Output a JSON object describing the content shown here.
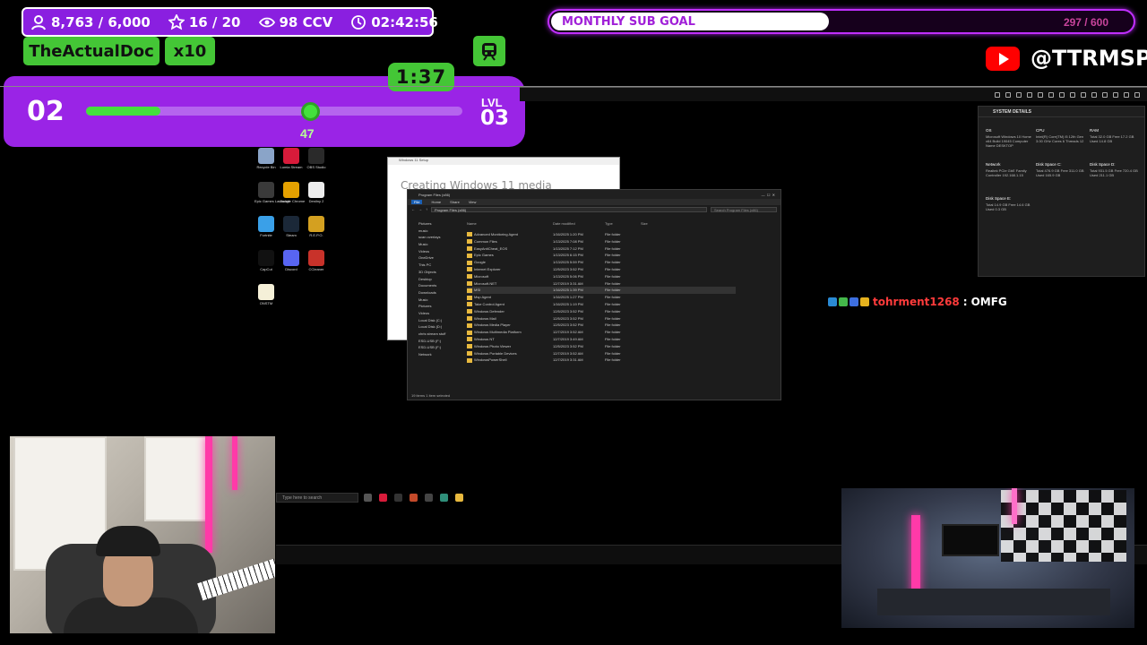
{
  "overlay": {
    "stats": {
      "followers": "8,763 / 6,000",
      "subs": "16 / 20",
      "viewers": "98 CCV",
      "uptime": "02:42:56"
    },
    "user_name": "TheActualDoc",
    "multiplier": "x10",
    "timer": "1:37",
    "level": {
      "current": "02",
      "next_label": "LVL",
      "next": "03",
      "progress_value": "47",
      "progress_fraction": 0.6
    },
    "goal": {
      "label": "MONTHLY SUB GOAL",
      "value": "297 / 600",
      "fraction": 0.495
    },
    "youtube_handle": "@TTRMSP",
    "chat": {
      "user": "tohrment1268",
      "separator": ":",
      "message": "OMFG"
    }
  },
  "desktop": {
    "icons": [
      {
        "label": "Recycle Bin",
        "color": "#8aa4c8"
      },
      {
        "label": "Lumia Stream",
        "color": "#d81b3a"
      },
      {
        "label": "OBS Studio",
        "color": "#2a2a2a"
      },
      {
        "label": "Epic Games Launcher",
        "color": "#3a3a3a"
      },
      {
        "label": "Google Chrome",
        "color": "#e5a100"
      },
      {
        "label": "Destiny 2",
        "color": "#ececec"
      },
      {
        "label": "Fortnite",
        "color": "#3aa0e8"
      },
      {
        "label": "Steam",
        "color": "#1b2838"
      },
      {
        "label": "R.E.P.O.",
        "color": "#d4a020"
      },
      {
        "label": "CapCut",
        "color": "#111111"
      },
      {
        "label": "Discord",
        "color": "#5865f2"
      },
      {
        "label": "CCleaner",
        "color": "#c8322a"
      },
      {
        "label": "ONSTM",
        "color": "#f5f0d8"
      }
    ],
    "bg_window": {
      "title": "Windows 11 Setup",
      "heading": "Creating Windows 11 media"
    },
    "explorer": {
      "title": "Program Files (x86)",
      "ribbon": [
        "File",
        "Home",
        "Share",
        "View"
      ],
      "path": "Program Files (x86)",
      "search_placeholder": "Search Program Files (x86)",
      "nav": [
        "Pictures",
        "music",
        "scan overlays",
        "Music",
        "Videos",
        "OneDrive",
        "This PC",
        "3D Objects",
        "Desktop",
        "Documents",
        "Downloads",
        "Music",
        "Pictures",
        "Videos",
        "Local Disk (C:)",
        "Local Disk (D:)",
        "chris stream stuff",
        "ESD-USB (F:)",
        "ESD-USB (F:)",
        "Network"
      ],
      "columns": [
        "Name",
        "Date modified",
        "Type",
        "Size"
      ],
      "rows": [
        {
          "name": "Advanced Monitoring Agent",
          "date": "1/16/2025 1:20 PM",
          "type": "File folder"
        },
        {
          "name": "Common Files",
          "date": "1/13/2025 7:08 PM",
          "type": "File folder"
        },
        {
          "name": "EasyAntiCheat_EOS",
          "date": "1/13/2025 7:12 PM",
          "type": "File folder"
        },
        {
          "name": "Epic Games",
          "date": "1/13/2025 6:15 PM",
          "type": "File folder"
        },
        {
          "name": "Google",
          "date": "1/13/2025 5:59 PM",
          "type": "File folder"
        },
        {
          "name": "Internet Explorer",
          "date": "12/5/2023 3:52 PM",
          "type": "File folder"
        },
        {
          "name": "Microsoft",
          "date": "1/13/2025 5:06 PM",
          "type": "File folder"
        },
        {
          "name": "Microsoft.NET",
          "date": "12/7/2019 3:31 AM",
          "type": "File folder"
        },
        {
          "name": "MSI",
          "date": "1/16/2025 1:39 PM",
          "type": "File folder"
        },
        {
          "name": "Msp Agent",
          "date": "1/16/2025 1:27 PM",
          "type": "File folder"
        },
        {
          "name": "Take Control Agent",
          "date": "1/16/2025 1:19 PM",
          "type": "File folder"
        },
        {
          "name": "Windows Defender",
          "date": "12/5/2023 3:52 PM",
          "type": "File folder"
        },
        {
          "name": "Windows Mail",
          "date": "12/5/2023 3:52 PM",
          "type": "File folder"
        },
        {
          "name": "Windows Media Player",
          "date": "12/5/2023 3:52 PM",
          "type": "File folder"
        },
        {
          "name": "Windows Multimedia Platform",
          "date": "12/7/2019 3:52 AM",
          "type": "File folder"
        },
        {
          "name": "Windows NT",
          "date": "12/7/2019 3:49 AM",
          "type": "File folder"
        },
        {
          "name": "Windows Photo Viewer",
          "date": "12/5/2023 3:52 PM",
          "type": "File folder"
        },
        {
          "name": "Windows Portable Devices",
          "date": "12/7/2019 3:52 AM",
          "type": "File folder"
        },
        {
          "name": "WindowsPowerShell",
          "date": "12/7/2019 3:31 AM",
          "type": "File folder"
        }
      ],
      "status": "19 items   1 item selected"
    },
    "system_panel": {
      "title": "SYSTEM DETAILS",
      "cells": [
        {
          "head": "OS",
          "body": "Microsoft Windows 10 Home x64 Build 19045 Computer Name DESKTOP"
        },
        {
          "head": "CPU",
          "body": "Intel(R) Core(TM) i5 12th Gen 3.00 GHz Cores 6 Threads 12"
        },
        {
          "head": "RAM",
          "body": "Total 32.0 GB Free 17.2 GB Used 14.8 GB"
        },
        {
          "head": "Network",
          "body": "Realtek PCIe GbE Family Controller 192.168.1.15"
        },
        {
          "head": "Disk Space C:",
          "body": "Total 476.9 GB Free 311.0 GB Used 165.9 GB"
        },
        {
          "head": "Disk Space D:",
          "body": "Total 931.5 GB Free 720.4 GB Used 211.1 GB"
        },
        {
          "head": "Disk Space E:",
          "body": "Total 14.9 GB Free 14.6 GB Used 0.3 GB"
        }
      ]
    },
    "taskbar": {
      "search_placeholder": "Type here to search"
    }
  }
}
